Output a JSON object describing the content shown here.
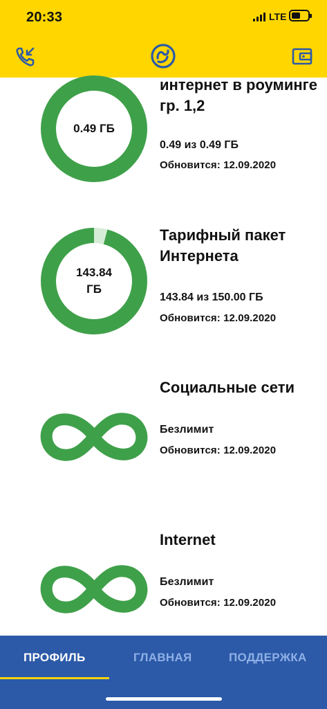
{
  "status_bar": {
    "time": "20:33",
    "network": "LTE",
    "battery_level": 0.4
  },
  "header": {
    "left_icon": "phone-incoming-icon",
    "center_logo": "lifecell-logo-icon",
    "right_icon": "wallet-icon",
    "accent_color": "#ffd600"
  },
  "packages": [
    {
      "title": "интернет в роуминге гр. 1,2",
      "ring_label": "0.49 ГБ",
      "amount": "0.49 из 0.49 ГБ",
      "update": "Обновится: 12.09.2020",
      "used_fraction": 1.0
    },
    {
      "title": "Тарифный пакет Интернета",
      "ring_label": "143.84 ГБ",
      "amount": "143.84 из 150.00 ГБ",
      "update": "Обновится: 12.09.2020",
      "used_fraction": 0.959
    },
    {
      "title": "Социальные сети",
      "status": "Безлимит",
      "update": "Обновится: 12.09.2020",
      "icon": "infinity-icon"
    },
    {
      "title": "Internet",
      "status": "Безлимит",
      "update": "Обновится: 12.09.2020",
      "icon": "infinity-icon"
    }
  ],
  "colors": {
    "ring": "#3fa04a",
    "ring_remaining": "#d6ecd6",
    "nav_bg": "#2c5aa8"
  },
  "nav": {
    "tabs": [
      "ПРОФИЛЬ",
      "ГЛАВНАЯ",
      "ПОДДЕРЖКА"
    ],
    "active": "ПРОФИЛЬ"
  }
}
